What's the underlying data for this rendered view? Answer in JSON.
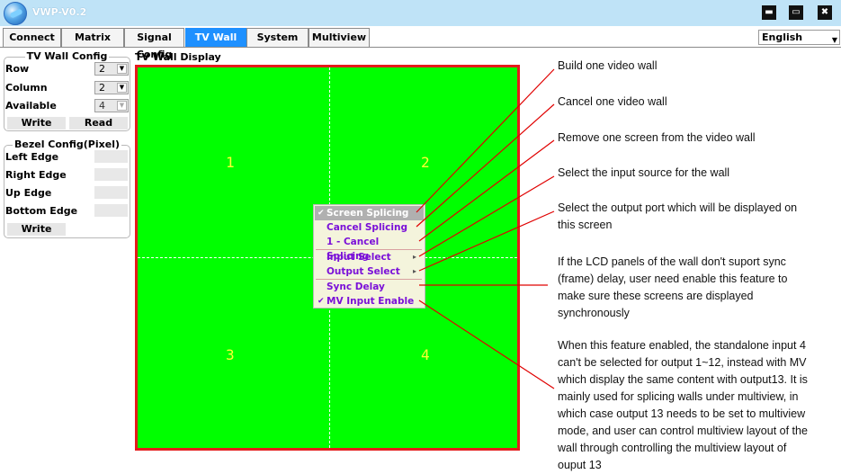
{
  "window": {
    "title": "VWP-V0.2"
  },
  "window_buttons": {
    "minimize": "▬",
    "maximize": "▭",
    "close": "✖"
  },
  "tabs": [
    "Connect",
    "Matrix",
    "Signal Config",
    "TV Wall",
    "System",
    "Multiview"
  ],
  "active_tab": "TV Wall",
  "language": {
    "selected": "English"
  },
  "tv_wall_config": {
    "title": "TV Wall Config",
    "row_label": "Row",
    "row_value": "2",
    "column_label": "Column",
    "column_value": "2",
    "available_label": "Available",
    "available_value": "4",
    "write_label": "Write",
    "read_label": "Read"
  },
  "bezel_config": {
    "title": "Bezel Config(Pixel)",
    "left_label": "Left Edge",
    "right_label": "Right Edge",
    "up_label": "Up Edge",
    "bottom_label": "Bottom Edge",
    "write_label": "Write"
  },
  "display": {
    "label": "TV Wall Display",
    "screens": [
      "1",
      "2",
      "3",
      "4"
    ],
    "colors": {
      "wall": "#00ff00",
      "border": "#e51b1b",
      "number": "#ffff33"
    }
  },
  "context_menu": {
    "items": [
      {
        "label": "Screen Splicing",
        "checked": true,
        "highlight": true
      },
      {
        "label": "Cancel Splicing"
      },
      {
        "label": "1 - Cancel Splicing"
      },
      {
        "label": "Input Select",
        "submenu": true
      },
      {
        "label": "Output Select",
        "submenu": true
      },
      {
        "label": "Sync Delay"
      },
      {
        "label": "MV Input Enable",
        "checked": true
      }
    ]
  },
  "annotations": {
    "build": "Build one video wall",
    "cancel": "Cancel one video wall",
    "remove": "Remove one screen from the video wall",
    "input": "Select the input source for the wall",
    "output_1": "Select the output port which will be displayed on",
    "output_2": "this screen",
    "sync_1": "If the LCD panels of the wall don't suport sync",
    "sync_2": "(frame) delay, user need enable this feature to",
    "sync_3": "make sure these screens are displayed",
    "sync_4": "synchronously",
    "mv_1": "When this feature enabled, the standalone input 4",
    "mv_2": "can't be selected for output 1~12, instead with MV",
    "mv_3": "which  display the same content with output13. It is",
    "mv_4": "mainly used for splicing walls under multiview, in",
    "mv_5": "which case output 13 needs to be set to multiview",
    "mv_6": "mode, and user can control multiview layout of the",
    "mv_7": "wall through controlling the multiview layout of",
    "mv_8": "ouput 13"
  }
}
